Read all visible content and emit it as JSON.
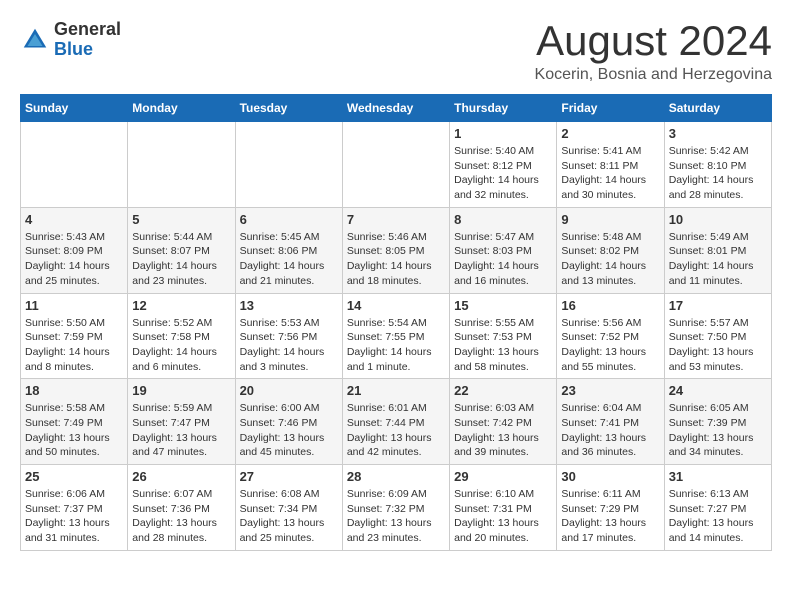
{
  "logo": {
    "general": "General",
    "blue": "Blue"
  },
  "header": {
    "month": "August 2024",
    "location": "Kocerin, Bosnia and Herzegovina"
  },
  "weekdays": [
    "Sunday",
    "Monday",
    "Tuesday",
    "Wednesday",
    "Thursday",
    "Friday",
    "Saturday"
  ],
  "weeks": [
    [
      {
        "day": "",
        "info": ""
      },
      {
        "day": "",
        "info": ""
      },
      {
        "day": "",
        "info": ""
      },
      {
        "day": "",
        "info": ""
      },
      {
        "day": "1",
        "info": "Sunrise: 5:40 AM\nSunset: 8:12 PM\nDaylight: 14 hours\nand 32 minutes."
      },
      {
        "day": "2",
        "info": "Sunrise: 5:41 AM\nSunset: 8:11 PM\nDaylight: 14 hours\nand 30 minutes."
      },
      {
        "day": "3",
        "info": "Sunrise: 5:42 AM\nSunset: 8:10 PM\nDaylight: 14 hours\nand 28 minutes."
      }
    ],
    [
      {
        "day": "4",
        "info": "Sunrise: 5:43 AM\nSunset: 8:09 PM\nDaylight: 14 hours\nand 25 minutes."
      },
      {
        "day": "5",
        "info": "Sunrise: 5:44 AM\nSunset: 8:07 PM\nDaylight: 14 hours\nand 23 minutes."
      },
      {
        "day": "6",
        "info": "Sunrise: 5:45 AM\nSunset: 8:06 PM\nDaylight: 14 hours\nand 21 minutes."
      },
      {
        "day": "7",
        "info": "Sunrise: 5:46 AM\nSunset: 8:05 PM\nDaylight: 14 hours\nand 18 minutes."
      },
      {
        "day": "8",
        "info": "Sunrise: 5:47 AM\nSunset: 8:03 PM\nDaylight: 14 hours\nand 16 minutes."
      },
      {
        "day": "9",
        "info": "Sunrise: 5:48 AM\nSunset: 8:02 PM\nDaylight: 14 hours\nand 13 minutes."
      },
      {
        "day": "10",
        "info": "Sunrise: 5:49 AM\nSunset: 8:01 PM\nDaylight: 14 hours\nand 11 minutes."
      }
    ],
    [
      {
        "day": "11",
        "info": "Sunrise: 5:50 AM\nSunset: 7:59 PM\nDaylight: 14 hours\nand 8 minutes."
      },
      {
        "day": "12",
        "info": "Sunrise: 5:52 AM\nSunset: 7:58 PM\nDaylight: 14 hours\nand 6 minutes."
      },
      {
        "day": "13",
        "info": "Sunrise: 5:53 AM\nSunset: 7:56 PM\nDaylight: 14 hours\nand 3 minutes."
      },
      {
        "day": "14",
        "info": "Sunrise: 5:54 AM\nSunset: 7:55 PM\nDaylight: 14 hours\nand 1 minute."
      },
      {
        "day": "15",
        "info": "Sunrise: 5:55 AM\nSunset: 7:53 PM\nDaylight: 13 hours\nand 58 minutes."
      },
      {
        "day": "16",
        "info": "Sunrise: 5:56 AM\nSunset: 7:52 PM\nDaylight: 13 hours\nand 55 minutes."
      },
      {
        "day": "17",
        "info": "Sunrise: 5:57 AM\nSunset: 7:50 PM\nDaylight: 13 hours\nand 53 minutes."
      }
    ],
    [
      {
        "day": "18",
        "info": "Sunrise: 5:58 AM\nSunset: 7:49 PM\nDaylight: 13 hours\nand 50 minutes."
      },
      {
        "day": "19",
        "info": "Sunrise: 5:59 AM\nSunset: 7:47 PM\nDaylight: 13 hours\nand 47 minutes."
      },
      {
        "day": "20",
        "info": "Sunrise: 6:00 AM\nSunset: 7:46 PM\nDaylight: 13 hours\nand 45 minutes."
      },
      {
        "day": "21",
        "info": "Sunrise: 6:01 AM\nSunset: 7:44 PM\nDaylight: 13 hours\nand 42 minutes."
      },
      {
        "day": "22",
        "info": "Sunrise: 6:03 AM\nSunset: 7:42 PM\nDaylight: 13 hours\nand 39 minutes."
      },
      {
        "day": "23",
        "info": "Sunrise: 6:04 AM\nSunset: 7:41 PM\nDaylight: 13 hours\nand 36 minutes."
      },
      {
        "day": "24",
        "info": "Sunrise: 6:05 AM\nSunset: 7:39 PM\nDaylight: 13 hours\nand 34 minutes."
      }
    ],
    [
      {
        "day": "25",
        "info": "Sunrise: 6:06 AM\nSunset: 7:37 PM\nDaylight: 13 hours\nand 31 minutes."
      },
      {
        "day": "26",
        "info": "Sunrise: 6:07 AM\nSunset: 7:36 PM\nDaylight: 13 hours\nand 28 minutes."
      },
      {
        "day": "27",
        "info": "Sunrise: 6:08 AM\nSunset: 7:34 PM\nDaylight: 13 hours\nand 25 minutes."
      },
      {
        "day": "28",
        "info": "Sunrise: 6:09 AM\nSunset: 7:32 PM\nDaylight: 13 hours\nand 23 minutes."
      },
      {
        "day": "29",
        "info": "Sunrise: 6:10 AM\nSunset: 7:31 PM\nDaylight: 13 hours\nand 20 minutes."
      },
      {
        "day": "30",
        "info": "Sunrise: 6:11 AM\nSunset: 7:29 PM\nDaylight: 13 hours\nand 17 minutes."
      },
      {
        "day": "31",
        "info": "Sunrise: 6:13 AM\nSunset: 7:27 PM\nDaylight: 13 hours\nand 14 minutes."
      }
    ]
  ]
}
